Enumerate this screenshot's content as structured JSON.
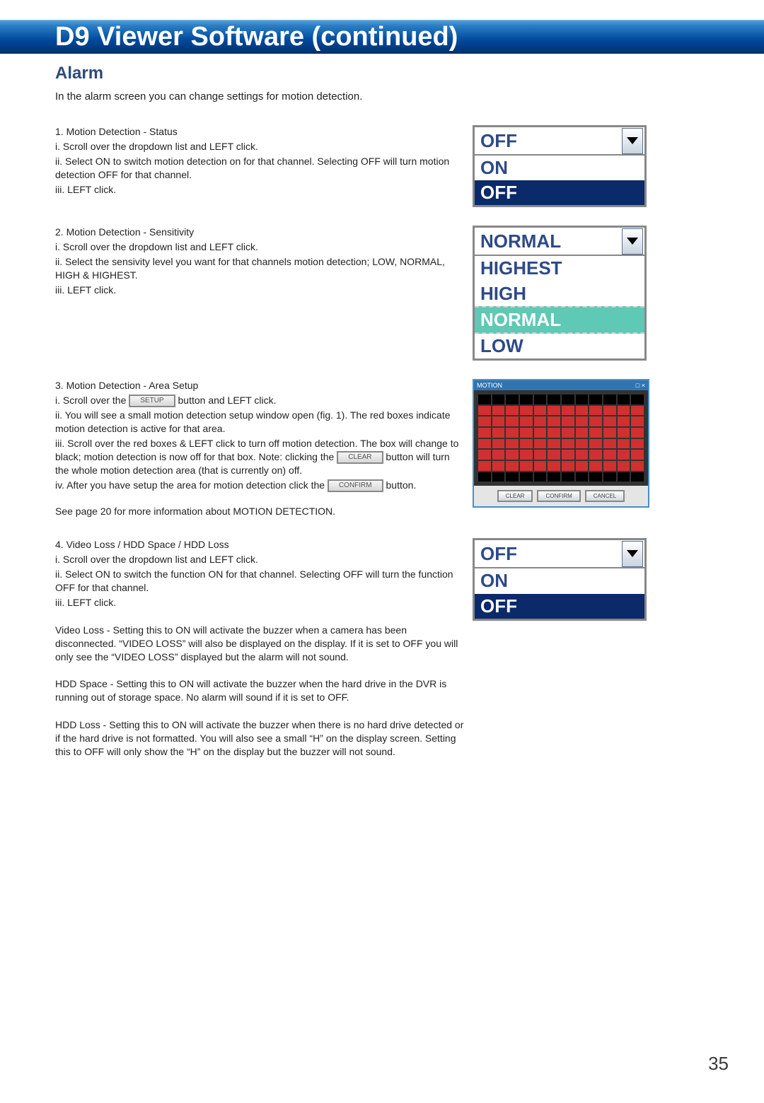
{
  "header": {
    "title": "D9 Viewer Software (continued)"
  },
  "section": {
    "title": "Alarm",
    "intro": "In the alarm screen you can change settings for motion detection."
  },
  "block1": {
    "h": "1. Motion Detection - Status",
    "l1": "i. Scroll over the dropdown list and LEFT click.",
    "l2": "ii. Select ON to switch motion detection on for that channel. Selecting OFF will turn motion detection OFF for that channel.",
    "l3": "iii. LEFT click.",
    "dd_header": "OFF",
    "dd_items": [
      "ON",
      "OFF"
    ]
  },
  "block2": {
    "h": "2. Motion Detection - Sensitivity",
    "l1": "i. Scroll over the dropdown list and LEFT click.",
    "l2": "ii. Select the sensivity level you want for that channels motion detection; LOW, NORMAL, HIGH & HIGHEST.",
    "l3": "iii. LEFT click.",
    "dd_header": "NORMAL",
    "dd_items": [
      "HIGHEST",
      "HIGH",
      "NORMAL",
      "LOW"
    ]
  },
  "block3": {
    "h": "3. Motion Detection - Area Setup",
    "l1a": "i. Scroll over the ",
    "l1b": " button and LEFT click.",
    "btn_setup": "SETUP",
    "l2": "ii. You will see a small motion detection setup window open (fig. 1). The red boxes indicate motion detection is active for that area.",
    "l3a": "iii. Scroll over the red boxes & LEFT click to turn off motion detection. The box will change to black; motion detection is now off for that box. Note: clicking the ",
    "l3b": " button will turn the whole motion detection area (that is currently on) off.",
    "btn_clear": "CLEAR",
    "l4a": "iv. After you have setup the area for motion detection click the ",
    "l4b": " button.",
    "btn_confirm": "CONFIRM",
    "see_page": "See page 20 for more information about MOTION DETECTION.",
    "mw_title": "MOTION",
    "mw_btn1": "CLEAR",
    "mw_btn2": "CONFIRM",
    "mw_btn3": "CANCEL"
  },
  "block4": {
    "h": "4. Video Loss / HDD Space / HDD Loss",
    "l1": "i. Scroll over the dropdown list and LEFT click.",
    "l2": "ii. Select ON to switch the function ON for that channel. Selecting OFF will turn the function OFF for that channel.",
    "l3": "iii. LEFT click.",
    "dd_header": "OFF",
    "dd_items": [
      "ON",
      "OFF"
    ],
    "p1": "Video Loss - Setting this to ON will activate the buzzer when a camera has been disconnected. “VIDEO LOSS” will also be displayed on the display. If it is set to OFF you will only see the  “VIDEO LOSS” displayed but the alarm will not sound.",
    "p2": "HDD Space - Setting this to ON will activate the buzzer when the hard drive in the DVR is running out of storage space. No alarm will sound if it is set to OFF.",
    "p3": "HDD Loss - Setting this to ON will activate the buzzer when there is no hard drive detected or if the hard drive is not formatted. You will also see a small “H” on the display screen. Setting this to OFF will only show the “H” on the display but the buzzer will not sound."
  },
  "page_number": "35"
}
